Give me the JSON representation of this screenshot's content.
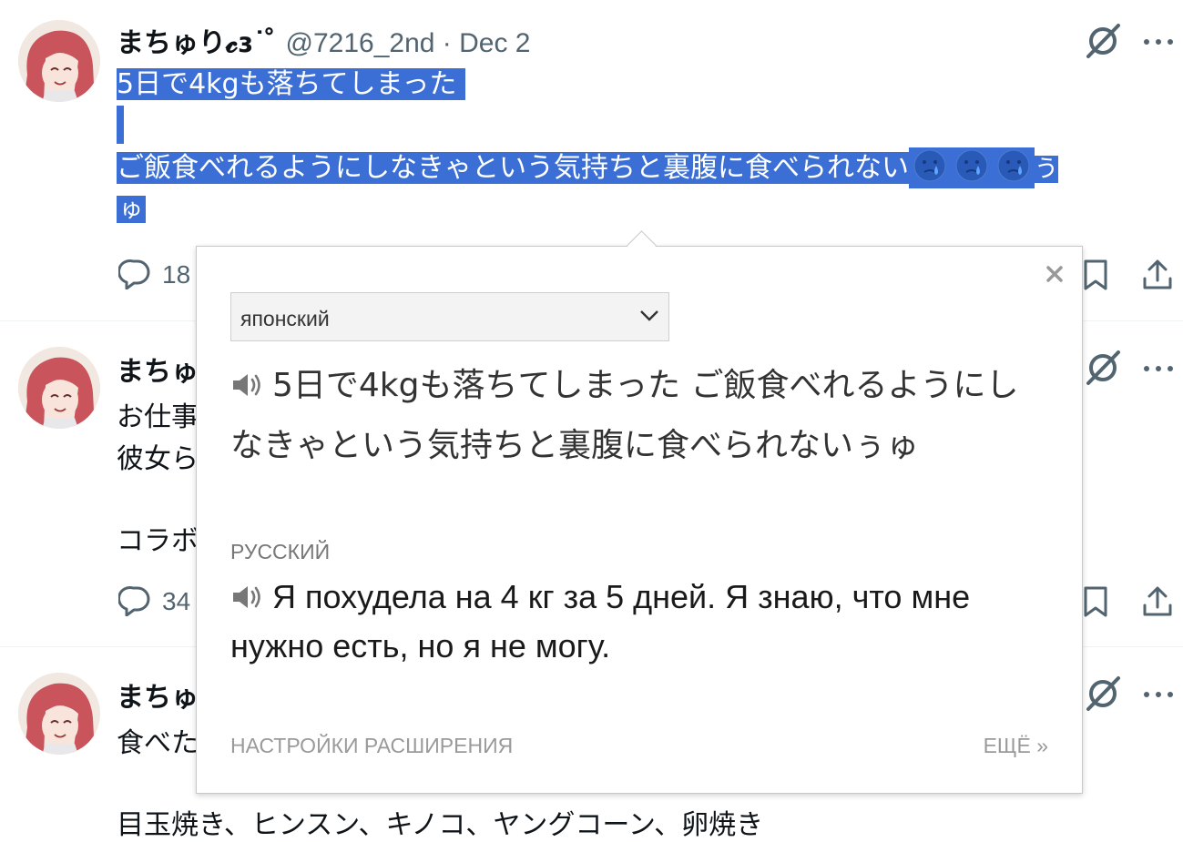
{
  "tweets": [
    {
      "author": "まちゅり𝓬ɜ˙ ̊",
      "handle": "@7216_2nd · Dec 2",
      "line1": "5日で4kgも落ちてしまった",
      "line2": "ご飯食べれるようにしなきゃという気持ちと裏腹に食べられない",
      "line2_tail": "う",
      "line3": "ゅ",
      "reply_count": "18",
      "emoji": "face-with-tear-icon"
    },
    {
      "author": "まちゅ",
      "line1": "お仕事",
      "line2": "彼女ら",
      "line3": "コラボ",
      "reply_count": "34"
    },
    {
      "author": "まちゅ",
      "line1": "食べた",
      "line2": "目玉焼き、ヒンスン、キノコ、ヤングコーン、卵焼き"
    }
  ],
  "popup": {
    "source_language": "японский",
    "source_text": "5日で4kgも落ちてしまった ご飯食べれるようにしなきゃという気持ちと裏腹に食べられないぅゅ",
    "target_language": "РУССКИЙ",
    "target_text": "Я похудела на 4 кг за 5 дней. Я знаю, что мне нужно есть, но я не могу.",
    "settings_link": "НАСТРОЙКИ РАСШИРЕНИЯ",
    "more_link": "ЕЩЁ »",
    "close": "×"
  },
  "colors": {
    "selection": "#3b6fd6",
    "muted": "#536471"
  }
}
